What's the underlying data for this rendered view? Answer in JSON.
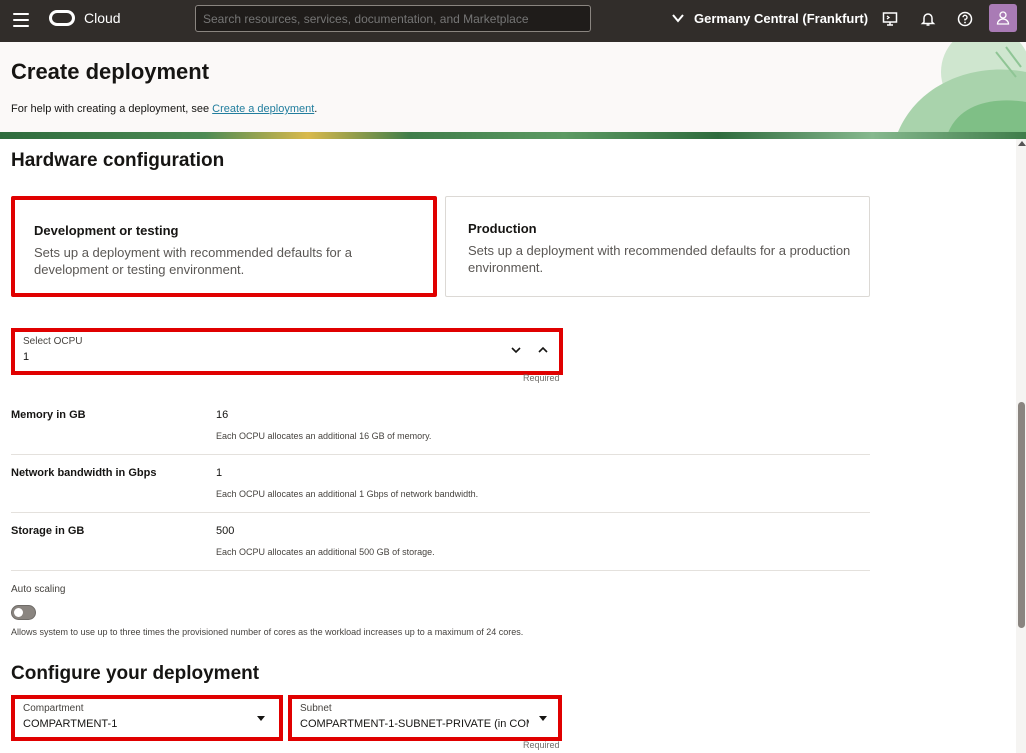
{
  "topbar": {
    "brand": "Cloud",
    "search_placeholder": "Search resources, services, documentation, and Marketplace",
    "region": "Germany Central (Frankfurt)"
  },
  "page": {
    "title": "Create deployment",
    "help_prefix": "For help with creating a deployment, see ",
    "help_link": "Create a deployment",
    "help_suffix": "."
  },
  "hardware": {
    "heading": "Hardware configuration",
    "options": [
      {
        "title": "Development or testing",
        "desc_1": "Sets up a deployment with recommended defaults for a",
        "desc_2": "development or testing environment.",
        "selected": true
      },
      {
        "title": "Production",
        "desc_1": "Sets up a deployment with recommended defaults for a production",
        "desc_2": "environment.",
        "selected": false
      }
    ],
    "ocpu": {
      "label": "Select OCPU",
      "value": "1",
      "required": "Required"
    },
    "rows": [
      {
        "label": "Memory in GB",
        "value": "16",
        "help": "Each OCPU allocates an additional 16 GB of memory."
      },
      {
        "label": "Network bandwidth in Gbps",
        "value": "1",
        "help": "Each OCPU allocates an additional 1 Gbps of network bandwidth."
      },
      {
        "label": "Storage in GB",
        "value": "500",
        "help": "Each OCPU allocates an additional 500 GB of storage."
      }
    ],
    "auto_scaling": {
      "label": "Auto scaling",
      "help": "Allows system to use up to three times the provisioned number of cores as the workload increases up to a maximum of 24 cores.",
      "enabled": false
    }
  },
  "configure": {
    "heading": "Configure your deployment",
    "compartment": {
      "label": "Compartment",
      "value": "COMPARTMENT-1"
    },
    "subnet": {
      "label": "Subnet",
      "value": "COMPARTMENT-1-SUBNET-PRIVATE (in COM",
      "required": "Required"
    }
  },
  "colors": {
    "topbar": "#312d2a",
    "highlight": "#e00000",
    "link": "#227e9e"
  }
}
